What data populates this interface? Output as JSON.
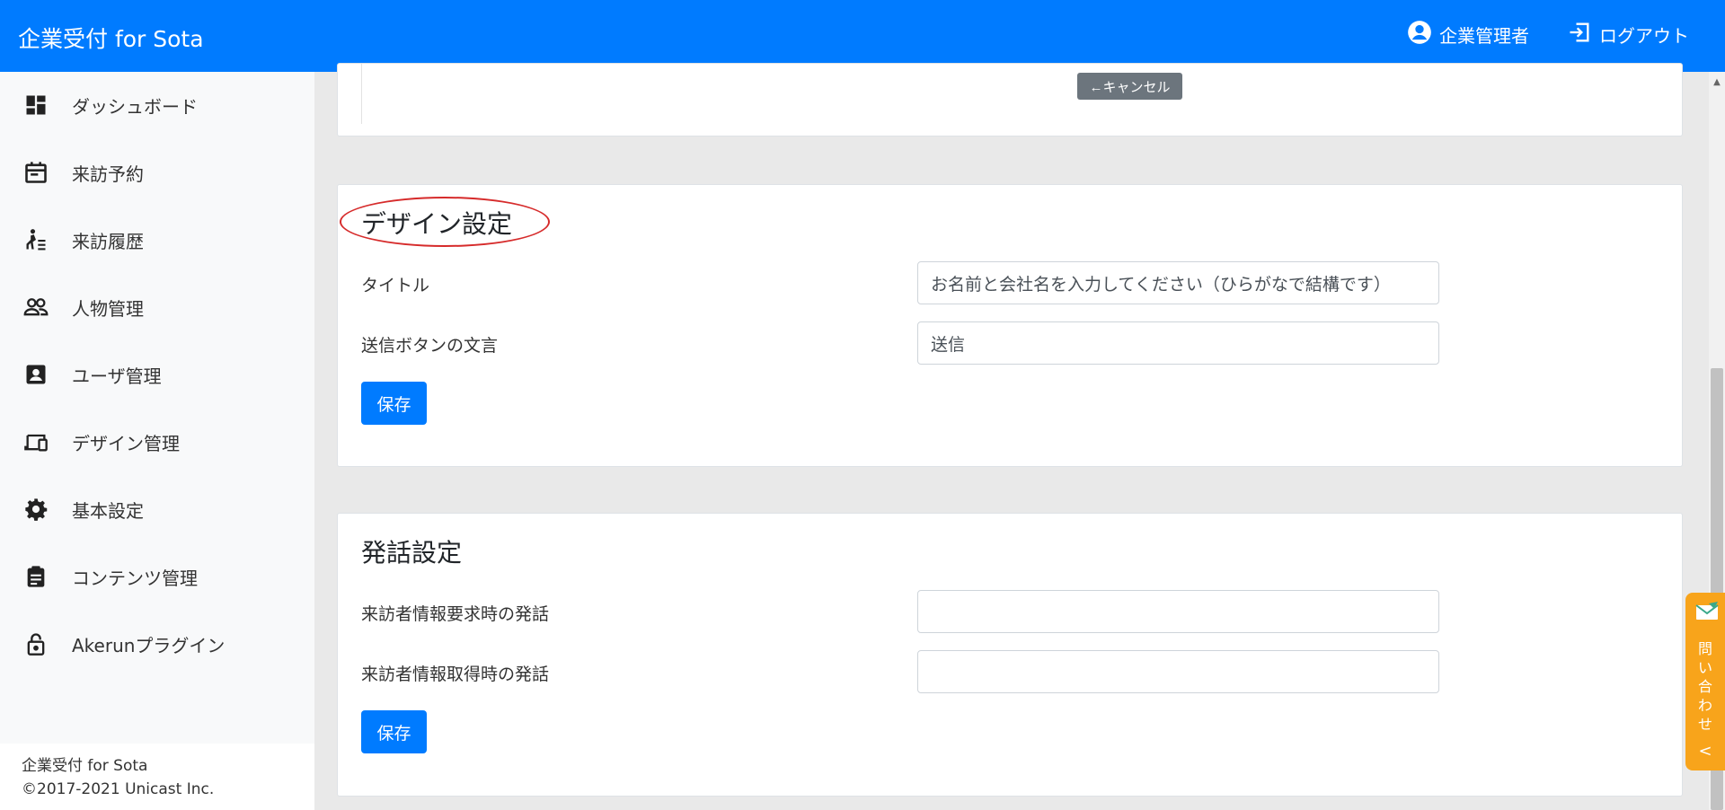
{
  "header": {
    "brand": "企業受付 for Sota",
    "admin_label": "企業管理者",
    "logout_label": "ログアウト"
  },
  "sidebar": {
    "items": [
      {
        "label": "ダッシュボード",
        "icon": "dashboard-icon"
      },
      {
        "label": "来訪予約",
        "icon": "calendar-icon"
      },
      {
        "label": "来訪履歴",
        "icon": "walk-history-icon"
      },
      {
        "label": "人物管理",
        "icon": "people-icon"
      },
      {
        "label": "ユーザ管理",
        "icon": "user-badge-icon"
      },
      {
        "label": "デザイン管理",
        "icon": "devices-icon"
      },
      {
        "label": "基本設定",
        "icon": "gear-icon"
      },
      {
        "label": "コンテンツ管理",
        "icon": "clipboard-icon"
      },
      {
        "label": "Akerunプラグイン",
        "icon": "lock-icon"
      }
    ],
    "footer": {
      "line1": "企業受付 for Sota",
      "line2": "©2017-2021 Unicast Inc."
    }
  },
  "top_card": {
    "cancel_label": "←キャンセル"
  },
  "design_settings": {
    "title": "デザイン設定",
    "title_label": "タイトル",
    "title_value": "お名前と会社名を入力してください（ひらがなで結構です）",
    "send_button_label": "送信ボタンの文言",
    "send_button_value": "送信",
    "save_label": "保存"
  },
  "speech_settings": {
    "title": "発話設定",
    "request_label": "来訪者情報要求時の発話",
    "request_value": "",
    "acquired_label": "来訪者情報取得時の発話",
    "acquired_value": "",
    "save_label": "保存"
  },
  "contact_tab": {
    "label": "問い合わせ",
    "chevron": "<"
  },
  "colors": {
    "primary": "#007bff",
    "secondary": "#6c757d",
    "contact_tab": "#f8a41b",
    "annotation_circle": "#d62b2b"
  }
}
